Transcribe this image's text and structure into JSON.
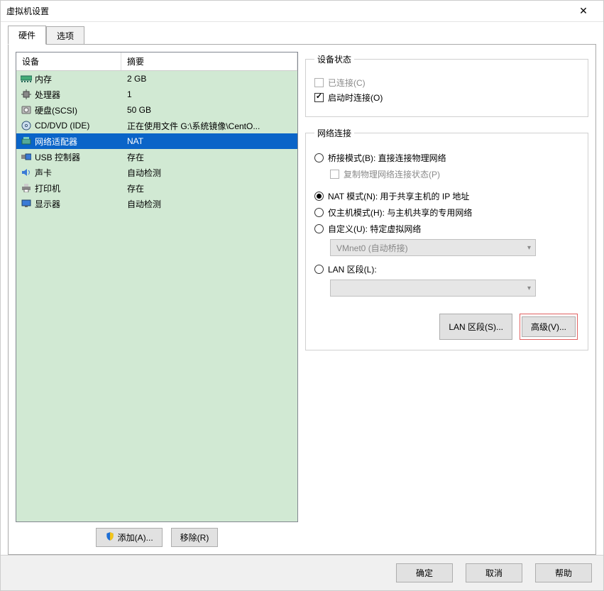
{
  "window": {
    "title": "虚拟机设置"
  },
  "tabs": {
    "hardware": "硬件",
    "options": "选项"
  },
  "table": {
    "head_device": "设备",
    "head_summary": "摘要",
    "rows": [
      {
        "icon": "memory-icon",
        "name": "内存",
        "summary": "2 GB"
      },
      {
        "icon": "cpu-icon",
        "name": "处理器",
        "summary": "1"
      },
      {
        "icon": "hdd-icon",
        "name": "硬盘(SCSI)",
        "summary": "50 GB"
      },
      {
        "icon": "disc-icon",
        "name": "CD/DVD (IDE)",
        "summary": "正在使用文件 G:\\系统镜像\\CentO..."
      },
      {
        "icon": "nic-icon",
        "name": "网络适配器",
        "summary": "NAT",
        "selected": true
      },
      {
        "icon": "usb-icon",
        "name": "USB 控制器",
        "summary": "存在"
      },
      {
        "icon": "sound-icon",
        "name": "声卡",
        "summary": "自动检测"
      },
      {
        "icon": "printer-icon",
        "name": "打印机",
        "summary": "存在"
      },
      {
        "icon": "display-icon",
        "name": "显示器",
        "summary": "自动检测"
      }
    ]
  },
  "left_buttons": {
    "add": "添加(A)...",
    "remove": "移除(R)"
  },
  "status": {
    "legend": "设备状态",
    "connected": "已连接(C)",
    "connect_on_start": "启动时连接(O)",
    "connect_on_start_checked": true,
    "connected_checked": false
  },
  "network": {
    "legend": "网络连接",
    "bridged": "桥接模式(B): 直接连接物理网络",
    "replicate": "复制物理网络连接状态(P)",
    "nat": "NAT 模式(N): 用于共享主机的 IP 地址",
    "hostonly": "仅主机模式(H): 与主机共享的专用网络",
    "custom": "自定义(U): 特定虚拟网络",
    "vmnet_value": "VMnet0 (自动桥接)",
    "lanseg": "LAN 区段(L):",
    "lanseg_value": "",
    "selected": "nat",
    "btn_lanseg": "LAN 区段(S)...",
    "btn_advanced": "高级(V)..."
  },
  "footer": {
    "ok": "确定",
    "cancel": "取消",
    "help": "帮助"
  }
}
